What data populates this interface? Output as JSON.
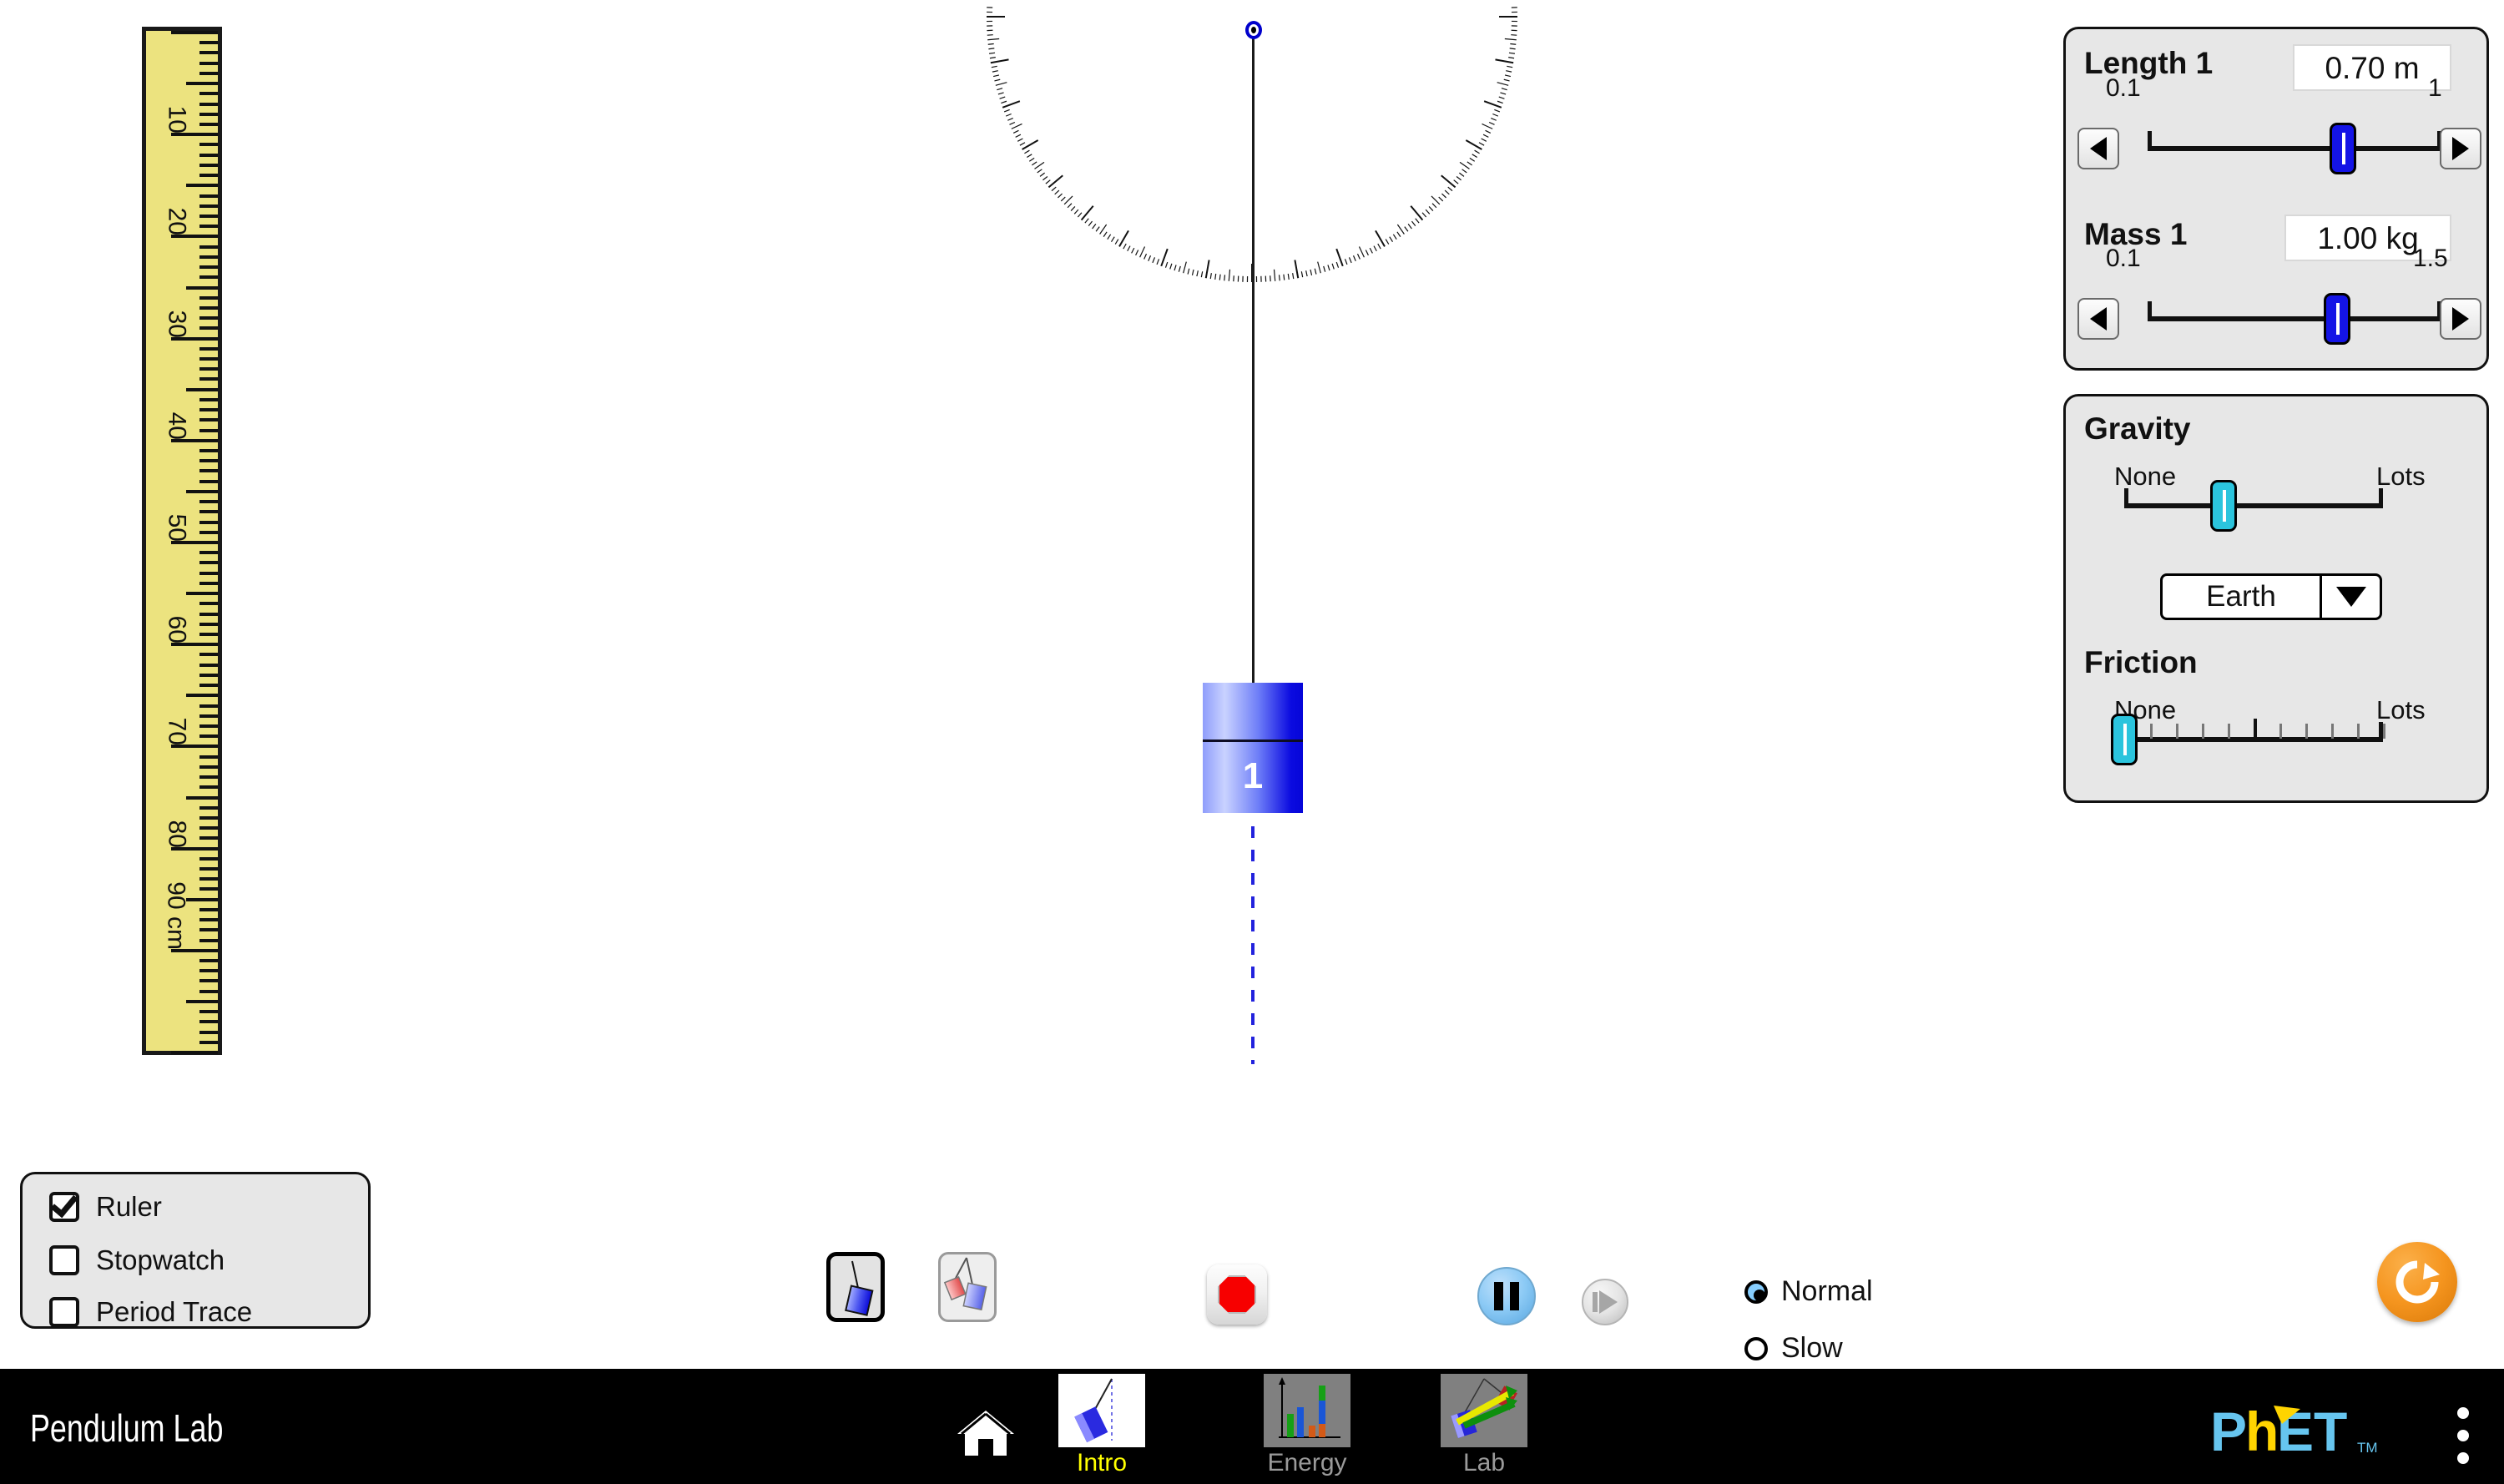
{
  "app": {
    "title": "Pendulum Lab",
    "trademark": "TM"
  },
  "ruler": {
    "unit_label": "90 cm",
    "tick_labels": [
      "10",
      "20",
      "30",
      "40",
      "50",
      "60",
      "70",
      "80"
    ],
    "bottom_label_value": "90",
    "bottom_label_unit": "cm"
  },
  "pendulum": {
    "bob_number": "1"
  },
  "controls": {
    "length": {
      "title": "Length 1",
      "value": "0.70 m",
      "min_label": "0.1",
      "max_label": "1",
      "fraction": 0.665,
      "left_arrow": "◀",
      "right_arrow": "▶"
    },
    "mass": {
      "title": "Mass 1",
      "value": "1.00 kg",
      "min_label": "0.1",
      "max_label": "1.5",
      "fraction": 0.645,
      "left_arrow": "◀",
      "right_arrow": "▶"
    },
    "gravity": {
      "title": "Gravity",
      "min_label": "None",
      "max_label": "Lots",
      "fraction": 0.385,
      "selected_body": "Earth",
      "body_options": [
        "Earth"
      ]
    },
    "friction": {
      "title": "Friction",
      "min_label": "None",
      "max_label": "Lots",
      "fraction": 0.0
    }
  },
  "checkboxes": [
    {
      "label": "Ruler",
      "checked": true
    },
    {
      "label": "Stopwatch",
      "checked": false
    },
    {
      "label": "Period Trace",
      "checked": false
    }
  ],
  "toolbar": {
    "one_pendulum_label": "one-pendulum",
    "two_pendulum_label": "two-pendulums",
    "record_label": "stop-record",
    "pause_label": "pause",
    "step_label": "step-forward",
    "reset_label": "reset-all"
  },
  "speed": {
    "options": [
      {
        "label": "Normal",
        "selected": true
      },
      {
        "label": "Slow",
        "selected": false
      }
    ]
  },
  "navbar": {
    "home_label": "Home",
    "tabs": [
      {
        "label": "Intro",
        "active": true
      },
      {
        "label": "Energy",
        "active": false
      },
      {
        "label": "Lab",
        "active": false
      }
    ],
    "logo_text_1": "P",
    "logo_text_2": "h",
    "logo_text_3": "ET",
    "menu_label": "menu"
  },
  "colors": {
    "panel_bg": "#e7e7e7",
    "slider_blue": "#1414e6",
    "slider_cyan": "#2bc4dd",
    "bob_blue": "#0b0be0",
    "ruler_yellow": "#ece37f",
    "accent_orange": "#f5951f",
    "tab_active": "#ffff00",
    "phet_blue": "#66c5ef",
    "phet_yellow": "#ffd400",
    "navbar_bg": "#000000",
    "record_red": "#f70000",
    "pause_blue": "#8ccaf5"
  }
}
